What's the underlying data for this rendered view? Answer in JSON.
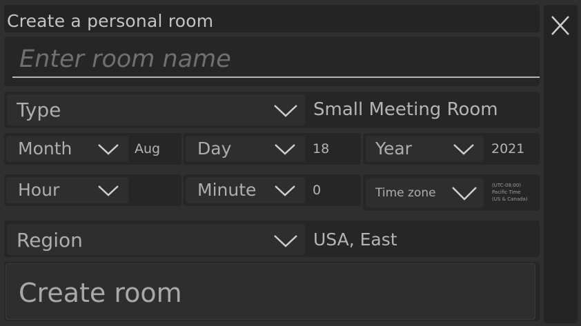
{
  "dialog": {
    "title": "Create a personal room",
    "close_icon": "close-icon"
  },
  "room_name": {
    "placeholder": "Enter room name",
    "value": ""
  },
  "type": {
    "label": "Type",
    "value": "Small Meeting Room"
  },
  "month": {
    "label": "Month",
    "value": "Aug"
  },
  "day": {
    "label": "Day",
    "value": "18"
  },
  "year": {
    "label": "Year",
    "value": "2021"
  },
  "hour": {
    "label": "Hour",
    "value": ""
  },
  "minute": {
    "label": "Minute",
    "value": "0"
  },
  "timezone": {
    "label": "Time zone",
    "value_lines": [
      "(UTC-08:00)",
      "Pacific Time",
      "(US & Canada)"
    ]
  },
  "region": {
    "label": "Region",
    "value": "USA, East"
  },
  "create_button": {
    "label": "Create room"
  },
  "colors": {
    "background": "#2f2f2f",
    "panel": "#262626",
    "text": "#b9b9b9"
  }
}
